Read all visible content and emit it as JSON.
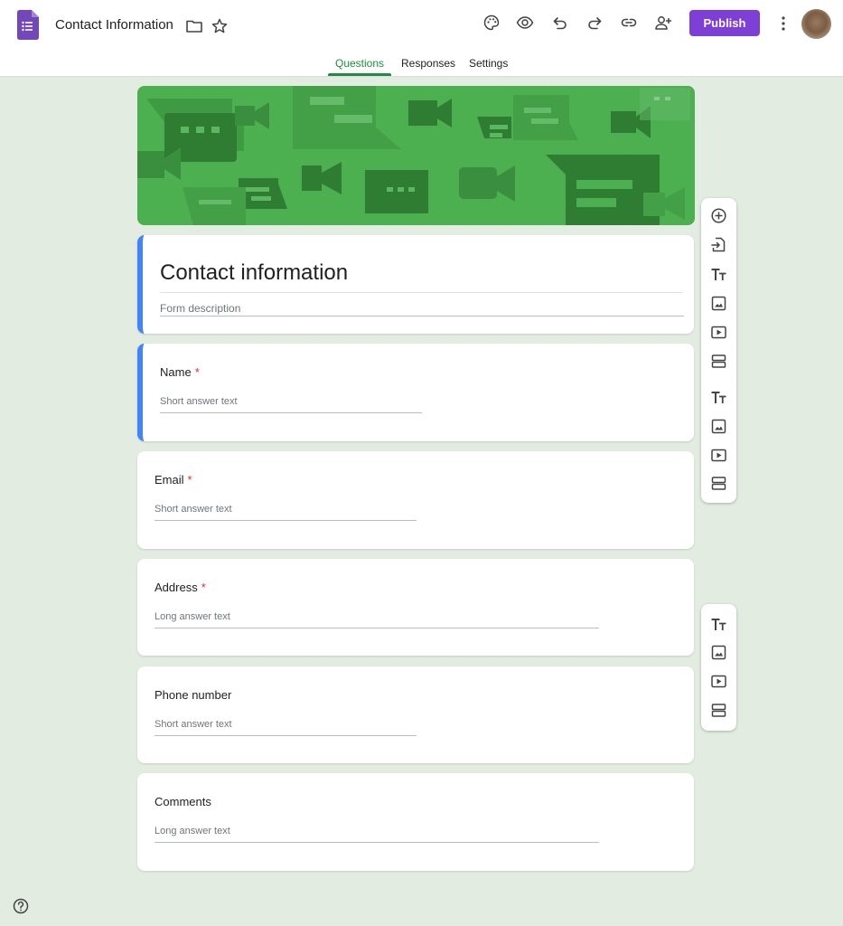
{
  "app": {
    "doc_title": "Contact Information",
    "publish_label": "Publish",
    "icons": [
      "forms-logo",
      "folder-icon",
      "star-icon",
      "palette-icon",
      "preview-eye-icon",
      "undo-icon",
      "redo-icon",
      "link-icon",
      "add-collaborator-icon",
      "more-vert-icon",
      "avatar",
      "help-icon"
    ],
    "colors": {
      "accent": "#7d3fd6",
      "tab_active": "#1e8e3e",
      "selected_border": "#4285f4",
      "background": "#e2ece1",
      "required": "#d93025"
    }
  },
  "tabs": [
    {
      "label": "Questions",
      "active": true
    },
    {
      "label": "Responses",
      "active": false
    },
    {
      "label": "Settings",
      "active": false
    }
  ],
  "form": {
    "title": "Contact information",
    "description_placeholder": "Form description"
  },
  "questions": [
    {
      "label": "Name",
      "required": "*",
      "hint": "Short answer text",
      "type": "short"
    },
    {
      "label": "Email",
      "required": "*",
      "hint": "Short answer text",
      "type": "short"
    },
    {
      "label": "Address",
      "required": "*",
      "hint": "Long answer text",
      "type": "long"
    },
    {
      "label": "Phone number",
      "required": "",
      "hint": "Short answer text",
      "type": "short"
    },
    {
      "label": "Comments",
      "required": "",
      "hint": "Long answer text",
      "type": "long"
    }
  ],
  "floating_toolbar": {
    "main": [
      "add-question-icon",
      "import-questions-icon",
      "add-title-icon",
      "add-image-icon",
      "add-video-icon",
      "add-section-icon",
      "add-title-icon",
      "add-image-icon",
      "add-video-icon",
      "add-section-icon"
    ],
    "secondary": [
      "add-title-icon",
      "add-image-icon",
      "add-video-icon",
      "add-section-icon"
    ]
  }
}
